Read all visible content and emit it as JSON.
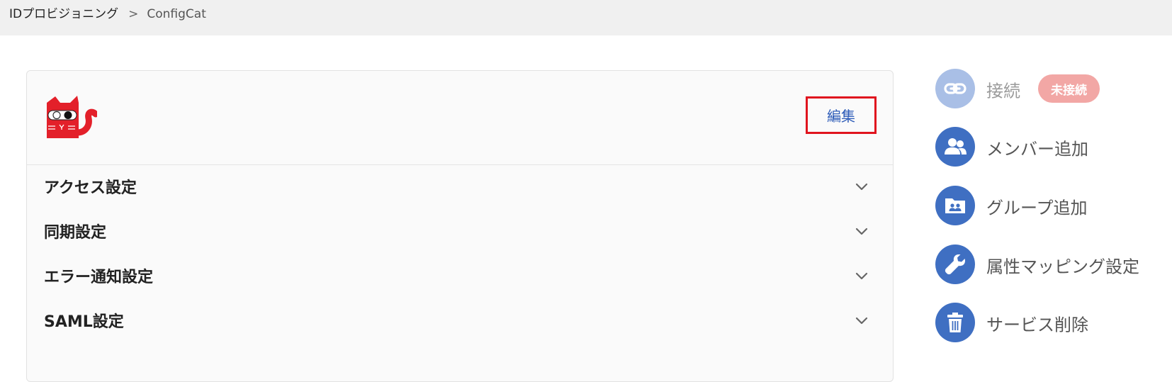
{
  "breadcrumb": {
    "parent": "IDプロビジョニング",
    "separator": ">",
    "current": "ConfigCat"
  },
  "card": {
    "logo_icon": "configcat-cat-logo",
    "edit_label": "編集",
    "sections": [
      {
        "label": "アクセス設定",
        "icon": "chevron-down-icon"
      },
      {
        "label": "同期設定",
        "icon": "chevron-down-icon"
      },
      {
        "label": "エラー通知設定",
        "icon": "chevron-down-icon"
      },
      {
        "label": "SAML設定",
        "icon": "chevron-down-icon"
      }
    ]
  },
  "actions": {
    "connect": {
      "label": "接続",
      "icon": "link-icon",
      "status": "未接続"
    },
    "add_member": {
      "label": "メンバー追加",
      "icon": "users-icon"
    },
    "add_group": {
      "label": "グループ追加",
      "icon": "group-folder-icon"
    },
    "attribute_mapping": {
      "label": "属性マッピング設定",
      "icon": "wrench-icon"
    },
    "delete_service": {
      "label": "サービス削除",
      "icon": "trash-icon"
    }
  },
  "colors": {
    "accent": "#3f6fc2",
    "accent_disabled": "#a9bfe6",
    "edit_highlight": "#e0141e",
    "status_badge": "#f2a7a5",
    "link_text": "#2c5bb8",
    "logo_red": "#e3202a"
  }
}
